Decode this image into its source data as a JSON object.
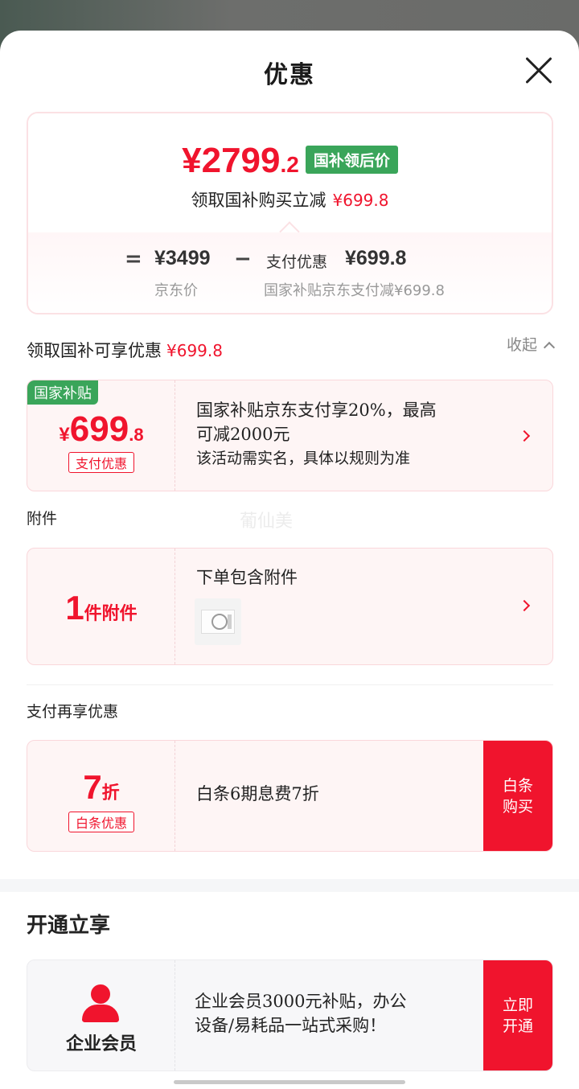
{
  "header": {
    "title": "优惠"
  },
  "summary": {
    "price_int": "¥2799",
    "price_dec": ".2",
    "price_tag": "国补领后价",
    "subtitle": "领取国补购买立减",
    "subtitle_amount": "¥699.8",
    "equals": "=",
    "jd_price": "¥3499",
    "jd_price_label": "京东价",
    "minus": "−",
    "pay_label": "支付优惠",
    "pay_amount": "¥699.8",
    "pay_desc": "国家补贴京东支付减¥699.8"
  },
  "benefits": {
    "heading": "领取国补可享优惠",
    "heading_amount": "¥699.8",
    "collapse_label": "收起"
  },
  "subsidy_card": {
    "corner_tag": "国家补贴",
    "currency": "¥",
    "amount_int": "699",
    "amount_dec": ".8",
    "tag": "支付优惠",
    "line1": "国家补贴京东支付享20%，最高",
    "line2": "可减2000元",
    "line3": "该活动需实名，具体以规则为准"
  },
  "watermark": "葡仙美",
  "accessory": {
    "heading": "附件",
    "count": "1",
    "count_unit": "件附件",
    "desc": "下单包含附件"
  },
  "pay_more": {
    "heading": "支付再享优惠",
    "discount": "7",
    "discount_unit": "折",
    "tag": "白条优惠",
    "desc": "白条6期息费7折",
    "action_line1": "白条",
    "action_line2": "购买"
  },
  "open_now": {
    "heading": "开通立享",
    "member_label": "企业会员",
    "desc_line1": "企业会员3000元补贴，办公",
    "desc_line2": "设备/易耗品一站式采购！",
    "action_line1": "立即",
    "action_line2": "开通"
  },
  "colors": {
    "accent": "#f0142d",
    "green": "#3aa55a"
  }
}
